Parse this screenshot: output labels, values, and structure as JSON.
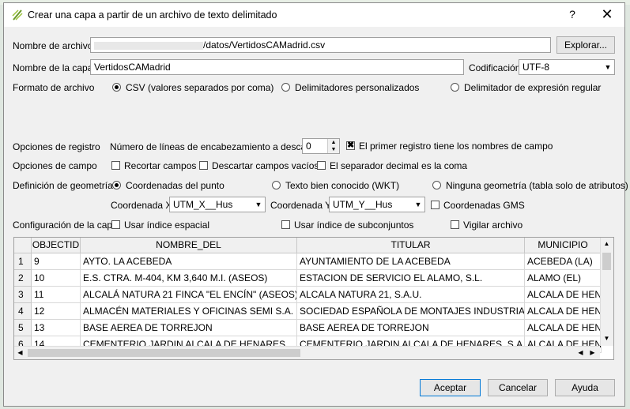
{
  "window": {
    "title": "Crear una capa a partir de un archivo de texto delimitado",
    "help": "?",
    "close": "✕"
  },
  "file": {
    "label": "Nombre de archivo",
    "value_visible": "/datos/VertidosCAMadrid.csv",
    "browse": "Explorar..."
  },
  "layer": {
    "label": "Nombre de la capa",
    "value": "VertidosCAMadrid",
    "encoding_label": "Codificación",
    "encoding_value": "UTF-8"
  },
  "format": {
    "label": "Formato de archivo",
    "options": [
      "CSV (valores separados por coma)",
      "Delimitadores personalizados",
      "Delimitador de expresión regular"
    ],
    "selected_index": 0
  },
  "record": {
    "label": "Opciones de registro",
    "skip_label": "Número de líneas de encabezamiento a descartar",
    "skip_value": "0",
    "first_record_label": "El primer registro tiene los nombres de campo",
    "first_record_checked": true
  },
  "field": {
    "label": "Opciones de campo",
    "trim": "Recortar campos",
    "discard_empty": "Descartar campos vacíos",
    "decimal_comma": "El separador decimal es la coma"
  },
  "geometry": {
    "label": "Definición de geometría",
    "options": [
      "Coordenadas del punto",
      "Texto bien conocido (WKT)",
      "Ninguna geometría (tabla solo de atributos)"
    ],
    "selected_index": 0,
    "x_label": "Coordenada X",
    "x_value": "UTM_X__Hus",
    "y_label": "Coordenada Y",
    "y_value": "UTM_Y__Hus",
    "dms_label": "Coordenadas GMS"
  },
  "layer_config": {
    "label": "Configuración de la capa",
    "spatial_index": "Usar índice espacial",
    "subset_index": "Usar índice de subconjuntos",
    "watch_file": "Vigilar archivo"
  },
  "table": {
    "columns": [
      "OBJECTID",
      "NOMBRE_DEL",
      "TITULAR",
      "MUNICIPIO"
    ],
    "rows": [
      {
        "n": "1",
        "cells": [
          "9",
          "AYTO. LA ACEBEDA",
          "AYUNTAMIENTO DE LA ACEBEDA",
          "ACEBEDA (LA)"
        ]
      },
      {
        "n": "2",
        "cells": [
          "10",
          "E.S. CTRA. M-404, KM 3,640 M.I. (ASEOS)",
          "ESTACION DE SERVICIO EL ALAMO, S.L.",
          "ALAMO (EL)"
        ]
      },
      {
        "n": "3",
        "cells": [
          "11",
          "ALCALÁ NATURA 21 FINCA \"EL ENCÍN\" (ASEOS)",
          "ALCALA NATURA 21, S.A.U.",
          "ALCALA DE HENARES"
        ]
      },
      {
        "n": "4",
        "cells": [
          "12",
          "ALMACÉN MATERIALES Y OFICINAS SEMI S.A. (ASEOS)",
          "SOCIEDAD ESPAÑOLA DE MONTAJES INDUSTRIALES, S.A.",
          "ALCALA DE HENARES"
        ]
      },
      {
        "n": "5",
        "cells": [
          "13",
          "BASE AEREA DE TORREJON",
          "BASE AEREA DE TORREJON",
          "ALCALA DE HENARES"
        ]
      },
      {
        "n": "6",
        "cells": [
          "14",
          "CEMENTERIO JARDIN ALCALA DE HENARES",
          "CEMENTERIO JARDIN ALCALA DE HENARES, S.A.",
          "ALCALA DE HENARES"
        ]
      }
    ]
  },
  "buttons": {
    "ok": "Aceptar",
    "cancel": "Cancelar",
    "help": "Ayuda"
  }
}
